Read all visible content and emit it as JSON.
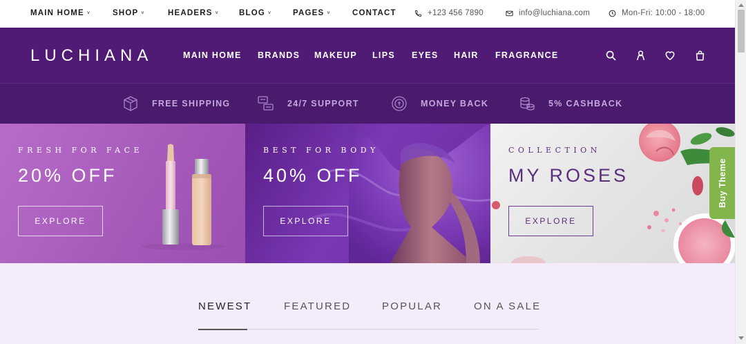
{
  "topbar": {
    "nav": [
      {
        "label": "MAIN HOME",
        "has_caret": true
      },
      {
        "label": "SHOP",
        "has_caret": true
      },
      {
        "label": "HEADERS",
        "has_caret": true
      },
      {
        "label": "BLOG",
        "has_caret": true
      },
      {
        "label": "PAGES",
        "has_caret": true
      },
      {
        "label": "CONTACT",
        "has_caret": false
      }
    ],
    "caret": "˅",
    "phone": "+123 456 7890",
    "email": "info@luchiana.com",
    "hours": "Mon-Fri: 10:00 - 18:00"
  },
  "header": {
    "logo": "LUCHIANA",
    "nav": [
      "MAIN HOME",
      "BRANDS",
      "MAKEUP",
      "LIPS",
      "EYES",
      "HAIR",
      "FRAGRANCE"
    ],
    "icons": [
      "search-icon",
      "user-icon",
      "heart-icon",
      "cart-icon"
    ]
  },
  "features": [
    {
      "label": "FREE SHIPPING",
      "icon": "box-icon"
    },
    {
      "label": "24/7 SUPPORT",
      "icon": "chat-icon"
    },
    {
      "label": "MONEY BACK",
      "icon": "coin-icon"
    },
    {
      "label": "5% CASHBACK",
      "icon": "coins-stack-icon"
    }
  ],
  "banners": [
    {
      "subtitle": "FRESH FOR FACE",
      "title": "20% OFF",
      "button": "EXPLORE"
    },
    {
      "subtitle": "BEST FOR BODY",
      "title": "40% OFF",
      "button": "EXPLORE"
    },
    {
      "subtitle": "COLLECTION",
      "title": "MY ROSES",
      "button": "EXPLORE"
    }
  ],
  "buy_theme": "Buy Theme",
  "product_tabs": {
    "items": [
      "NEWEST",
      "FEATURED",
      "POPULAR",
      "ON A SALE"
    ],
    "active": "NEWEST"
  },
  "colors": {
    "header_bg": "#4f1b74",
    "features_bg": "#4a1a6c",
    "features_text": "#c2a8dc",
    "buy_theme_bg": "#82b54b",
    "lower_bg": "#f5ecfb"
  }
}
